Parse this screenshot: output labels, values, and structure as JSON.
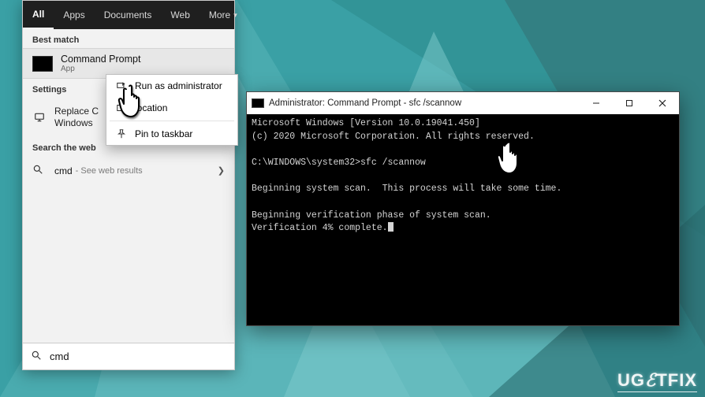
{
  "search": {
    "tabs": {
      "all": "All",
      "apps": "Apps",
      "documents": "Documents",
      "web": "Web",
      "more": "More"
    },
    "best_match_heading": "Best match",
    "best_match": {
      "title": "Command Prompt",
      "subtitle": "App"
    },
    "settings_heading": "Settings",
    "settings_item": "Replace Command Prompt with Windows PowerShell",
    "settings_item_short1": "Replace C",
    "settings_item_short2": "Windows",
    "web_heading": "Search the web",
    "web_term": "cmd",
    "web_sub": "- See web results",
    "box_value": "cmd"
  },
  "context_menu": {
    "run_admin": "Run as administrator",
    "open_location": "Open file location",
    "open_location_visible": "location",
    "pin_taskbar": "Pin to taskbar"
  },
  "cmd": {
    "title": "Administrator: Command Prompt - sfc  /scannow",
    "lines": {
      "l1": "Microsoft Windows [Version 10.0.19041.450]",
      "l2": "(c) 2020 Microsoft Corporation. All rights reserved.",
      "l3": "",
      "l4": "C:\\WINDOWS\\system32>sfc /scannow",
      "l5": "",
      "l6": "Beginning system scan.  This process will take some time.",
      "l7": "",
      "l8": "Beginning verification phase of system scan.",
      "l9": "Verification 4% complete."
    }
  },
  "watermark": "UGETFIX"
}
